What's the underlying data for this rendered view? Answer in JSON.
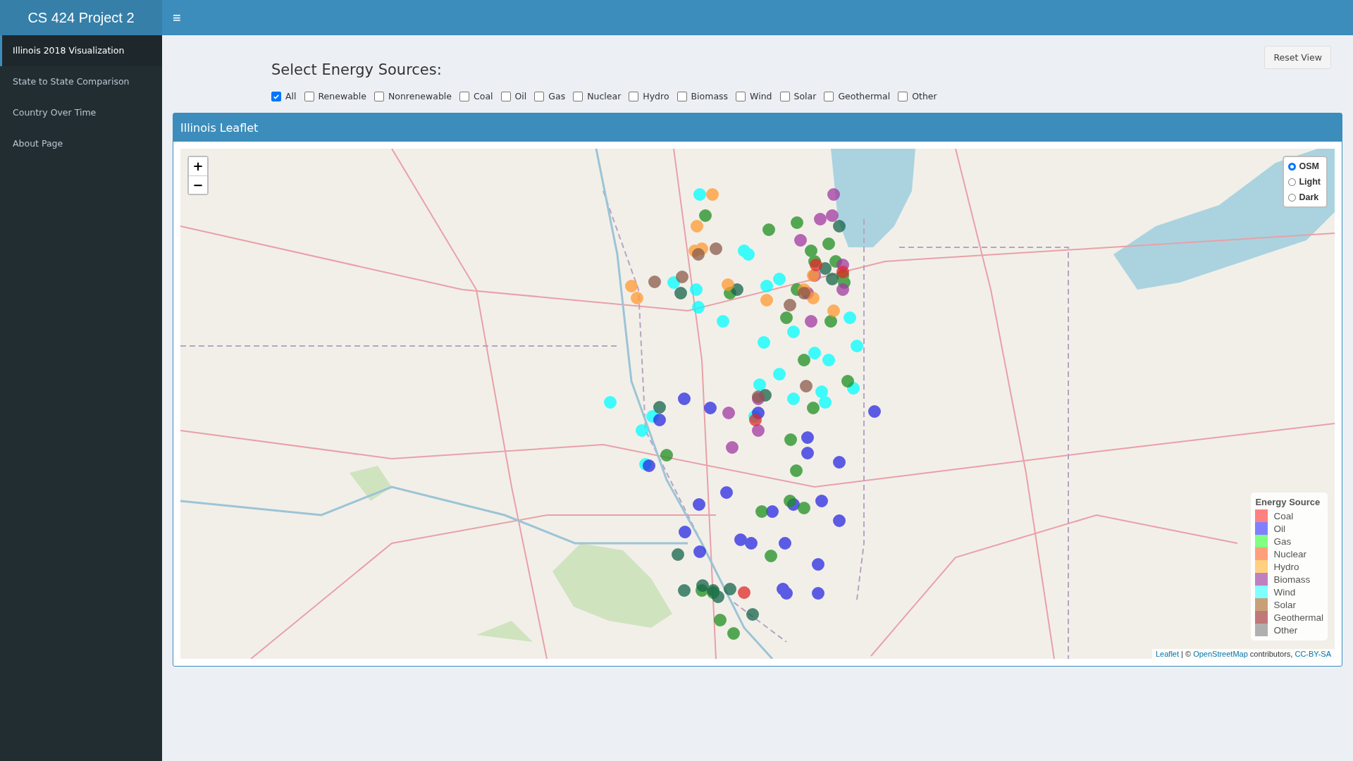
{
  "header": {
    "title": "CS 424 Project 2",
    "menu_toggle": "≡"
  },
  "sidebar": {
    "items": [
      {
        "label": "Illinois 2018 Visualization",
        "selected": true
      },
      {
        "label": "State to State Comparison",
        "selected": false
      },
      {
        "label": "Country Over Time",
        "selected": false
      },
      {
        "label": "About Page",
        "selected": false
      }
    ]
  },
  "reset_button": "Reset View",
  "filter": {
    "title": "Select Energy Sources:",
    "options": [
      {
        "label": "All",
        "checked": true
      },
      {
        "label": "Renewable",
        "checked": false
      },
      {
        "label": "Nonrenewable",
        "checked": false
      },
      {
        "label": "Coal",
        "checked": false
      },
      {
        "label": "Oil",
        "checked": false
      },
      {
        "label": "Gas",
        "checked": false
      },
      {
        "label": "Nuclear",
        "checked": false
      },
      {
        "label": "Hydro",
        "checked": false
      },
      {
        "label": "Biomass",
        "checked": false
      },
      {
        "label": "Wind",
        "checked": false
      },
      {
        "label": "Solar",
        "checked": false
      },
      {
        "label": "Geothermal",
        "checked": false
      },
      {
        "label": "Other",
        "checked": false
      }
    ]
  },
  "map_panel": {
    "title": "Illinois Leaflet",
    "zoom_in": "+",
    "zoom_out": "−",
    "layers": [
      {
        "label": "OSM",
        "selected": true
      },
      {
        "label": "Light",
        "selected": false
      },
      {
        "label": "Dark",
        "selected": false
      }
    ],
    "legend": {
      "title": "Energy Source",
      "items": [
        {
          "label": "Coal",
          "color": "#ff8080"
        },
        {
          "label": "Oil",
          "color": "#8080ff"
        },
        {
          "label": "Gas",
          "color": "#80ff80"
        },
        {
          "label": "Nuclear",
          "color": "#ffa07a"
        },
        {
          "label": "Hydro",
          "color": "#ffd080"
        },
        {
          "label": "Biomass",
          "color": "#bf80bf"
        },
        {
          "label": "Wind",
          "color": "#80ffff"
        },
        {
          "label": "Solar",
          "color": "#c8a078"
        },
        {
          "label": "Geothermal",
          "color": "#c07878"
        },
        {
          "label": "Other",
          "color": "#b0b0b0"
        }
      ]
    },
    "attribution": {
      "leaflet_link": "Leaflet",
      "separator": "| ©",
      "osm_link": "OpenStreetMap",
      "text": "contributors,",
      "license_link": "CC-BY-SA"
    }
  }
}
